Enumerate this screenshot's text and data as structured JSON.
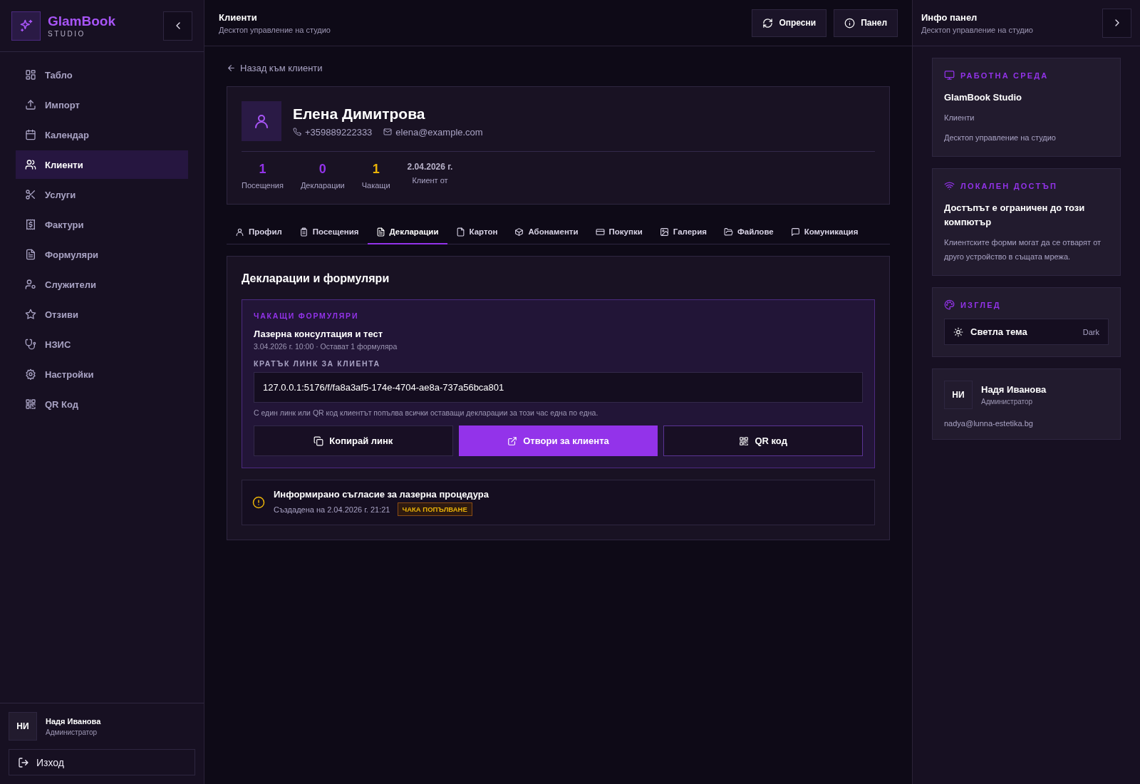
{
  "brand": {
    "name": "GlamBook",
    "subtitle": "STUDIO"
  },
  "sidebar": {
    "items": [
      {
        "label": "Табло",
        "selected": false
      },
      {
        "label": "Импорт",
        "selected": false
      },
      {
        "label": "Календар",
        "selected": false
      },
      {
        "label": "Клиенти",
        "selected": true
      },
      {
        "label": "Услуги",
        "selected": false
      },
      {
        "label": "Фактури",
        "selected": false
      },
      {
        "label": "Формуляри",
        "selected": false
      },
      {
        "label": "Служители",
        "selected": false
      },
      {
        "label": "Отзиви",
        "selected": false
      },
      {
        "label": "НЗИС",
        "selected": false
      },
      {
        "label": "Настройки",
        "selected": false
      },
      {
        "label": "QR Код",
        "selected": false
      }
    ],
    "user": {
      "initials": "НИ",
      "name": "Надя Иванова",
      "role": "Администратор"
    },
    "logout": "Изход"
  },
  "header": {
    "title": "Клиенти",
    "subtitle": "Десктоп управление на студио",
    "buttons": [
      "Опресни",
      "Панел"
    ]
  },
  "back_link": "Назад към клиенти",
  "client": {
    "name": "Елена Димитрова",
    "phone": "+359889222333",
    "email": "elena@example.com",
    "stats": [
      {
        "kind": "count",
        "value": "1",
        "label": "Посещения",
        "color": "#9333ea"
      },
      {
        "kind": "count",
        "value": "0",
        "label": "Декларации",
        "color": "#9333ea"
      },
      {
        "kind": "count",
        "value": "1",
        "label": "Чакащи",
        "color": "#eab308"
      },
      {
        "kind": "date",
        "value": "2.04.2026 г.",
        "label": "Клиент от"
      }
    ]
  },
  "tabs": [
    {
      "label": "Профил",
      "selected": false
    },
    {
      "label": "Посещения",
      "selected": false
    },
    {
      "label": "Декларации",
      "selected": true
    },
    {
      "label": "Картон",
      "selected": false
    },
    {
      "label": "Абонаменти",
      "selected": false
    },
    {
      "label": "Покупки",
      "selected": false
    },
    {
      "label": "Галерия",
      "selected": false
    },
    {
      "label": "Файлове",
      "selected": false
    },
    {
      "label": "Комуникация",
      "selected": false
    }
  ],
  "section": {
    "title": "Декларации и формуляри",
    "pending": {
      "heading": "ЧАКАЩИ ФОРМУЛЯРИ",
      "appointment": "Лазерна консултация и тест",
      "meta": "3.04.2026 г. 10:00 · Остават 1 формуляра",
      "link_label": "КРАТЪК ЛИНК ЗА КЛИЕНТА",
      "link": "127.0.0.1:5176/f/fa8a3af5-174e-4704-ae8a-737a56bca801",
      "hint": "С един линк или QR код клиентът попълва всички оставащи декларации за този час една по една.",
      "actions": [
        {
          "label": "Копирай линк",
          "kind": "secondary"
        },
        {
          "label": "Отвори за клиента",
          "kind": "primary"
        },
        {
          "label": "QR код",
          "kind": "outline"
        }
      ]
    },
    "declarations": [
      {
        "title": "Информирано съгласие за лазерна процедура",
        "created": "Създадена на 2.04.2026 г. 21:21",
        "status": "ЧАКА ПОПЪЛВАНЕ"
      }
    ]
  },
  "info_panel": {
    "title": "Инфо панел",
    "subtitle": "Десктоп управление на студио",
    "workspace": {
      "heading": "РАБОТНА СРЕДА",
      "name": "GlamBook Studio",
      "page": "Клиенти",
      "description": "Десктоп управление на студио"
    },
    "access": {
      "heading": "ЛОКАЛЕН ДОСТЪП",
      "title": "Достъпът е ограничен до този компютър",
      "text": "Клиентските форми могат да се отварят от друго устройство в същата мрежа."
    },
    "appearance": {
      "heading": "ИЗГЛЕД",
      "theme_label": "Светла тема",
      "theme_value": "Dark"
    },
    "user": {
      "initials": "НИ",
      "name": "Надя Иванова",
      "role": "Администратор",
      "email": "nadya@lunna-estetika.bg"
    }
  }
}
